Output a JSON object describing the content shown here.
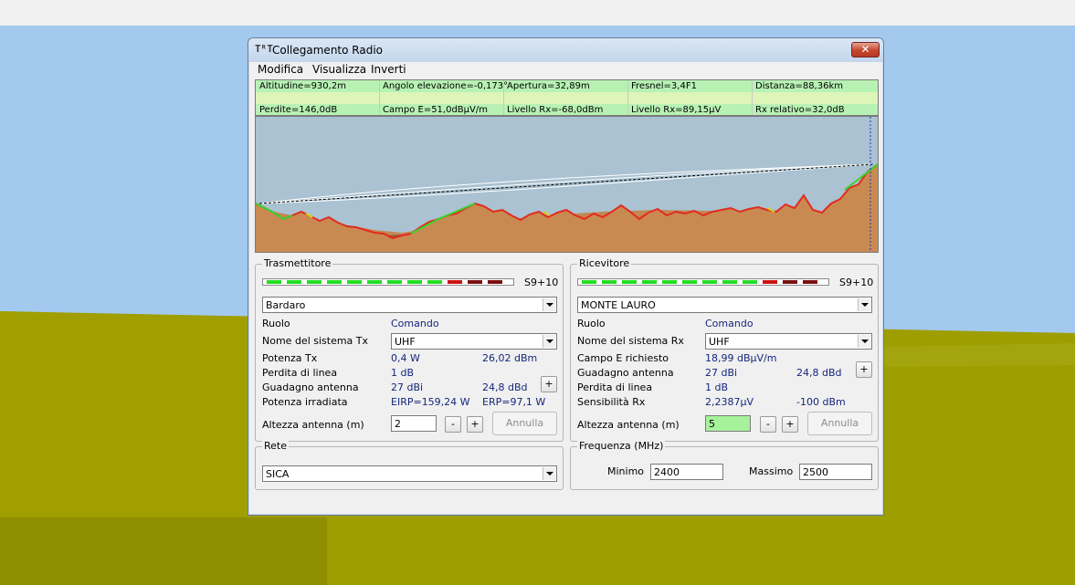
{
  "window": {
    "title": "Collegamento Radio",
    "close_glyph": "✕"
  },
  "menu": [
    {
      "label": "Modifica"
    },
    {
      "label": "Visualizza"
    },
    {
      "label": "Inverti"
    }
  ],
  "info_row1": [
    "Altitudine=930,2m",
    "Angolo elevazione=-0,173°",
    "Apertura=32,89m",
    "Fresnel=3,4F1",
    "Distanza=88,36km"
  ],
  "info_row2": [
    "Perdite=146,0dB",
    "Campo E=51,0dBµV/m",
    "Livello Rx=-68,0dBm",
    "Livello Rx=89,15µV",
    "Rx relativo=32,0dB"
  ],
  "tx": {
    "legend": "Trasmettitore",
    "meter_label": "S9+10",
    "station": "Bardaro",
    "role_label": "Ruolo",
    "role_value": "Comando",
    "system_label": "Nome del sistema Tx",
    "system_value": "UHF",
    "power_label": "Potenza Tx",
    "power_w": "0,4 W",
    "power_dbm": "26,02 dBm",
    "line_loss_label": "Perdita di linea",
    "line_loss_value": "1 dB",
    "gain_label": "Guadagno antenna",
    "gain_dbi": "27 dBi",
    "gain_dbd": "24,8 dBd",
    "radiated_label": "Potenza irradiata",
    "eirp": "EIRP=159,24 W",
    "erp": "ERP=97,1 W",
    "height_label": "Altezza antenna (m)",
    "height_value": "2",
    "minus": "-",
    "plus": "+",
    "undo": "Annulla"
  },
  "rx": {
    "legend": "Ricevitore",
    "meter_label": "S9+10",
    "station": "MONTE LAURO",
    "role_label": "Ruolo",
    "role_value": "Comando",
    "system_label": "Nome del sistema Rx",
    "system_value": "UHF",
    "field_label": "Campo E richiesto",
    "field_value": "18,99 dBµV/m",
    "gain_label": "Guadagno antenna",
    "gain_dbi": "27 dBi",
    "gain_dbd": "24,8 dBd",
    "line_loss_label": "Perdita di linea",
    "line_loss_value": "1 dB",
    "sens_label": "Sensibilità Rx",
    "sens_uv": "2,2387µV",
    "sens_dbm": "-100 dBm",
    "height_label": "Altezza antenna (m)",
    "height_value": "5",
    "minus": "-",
    "plus": "+",
    "undo": "Annulla"
  },
  "net": {
    "legend": "Rete",
    "value": "SICA"
  },
  "freq": {
    "legend": "Frequenza (MHz)",
    "min_label": "Minimo",
    "min_value": "2400",
    "max_label": "Massimo",
    "max_value": "2500"
  },
  "colors": {
    "terrain": "#c98a52",
    "terrain_dark": "#8e5b3a",
    "sky": "#aac2d2",
    "green_seg": "#22dd22",
    "red_seg": "#cc1111",
    "dark_red_seg": "#7a0f0f",
    "ground": "#a0a000"
  }
}
